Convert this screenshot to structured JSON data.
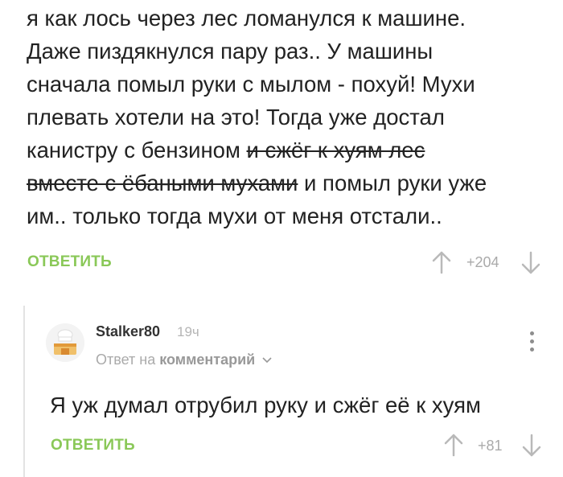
{
  "comment1": {
    "line1": "я как лось через лес ломанулся к машине.",
    "line2": "Даже пиздякнулся пару раз.. У машины",
    "line3": "сначала помыл руки с мылом - похуй! Мухи",
    "line4": "плевать хотели на это! Тогда уже достал",
    "line5_plain": "канистру с бензином ",
    "line5_strike": "и сжёг к хуям лес",
    "line6_strike": "вместе с ёбаными мухами",
    "line6_plain": " и помыл руки уже",
    "line7": "им.. только тогда мухи от меня отстали..",
    "reply_label": "ОТВЕТИТЬ",
    "score": "+204"
  },
  "comment2": {
    "username": "Stalker80",
    "time": "19ч",
    "reply_to_prefix": "Ответ на",
    "reply_to_target": "комментарий",
    "text": "Я уж думал отрубил руку и сжёг её к хуям",
    "reply_label": "ОТВЕТИТЬ",
    "score": "+81"
  },
  "icons": {
    "upvote": "arrow-up-icon",
    "downvote": "arrow-down-icon",
    "more": "more-vertical-icon",
    "expand": "chevron-down-icon",
    "avatar": "chef-hat-avatar"
  },
  "colors": {
    "accent_green": "#8ac858",
    "muted_gray": "#aaaaaa",
    "thread_line": "#e3e3e3"
  }
}
